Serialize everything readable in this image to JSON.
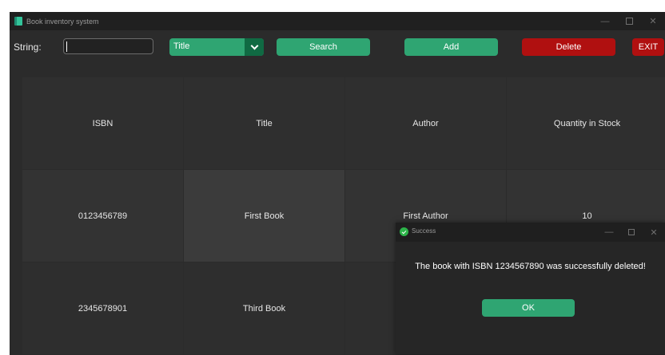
{
  "window": {
    "title": "Book inventory system",
    "controls": {
      "minimize": "—",
      "close": "✕"
    }
  },
  "toolbar": {
    "string_label": "String:",
    "search_value": "",
    "field_select_value": "Title",
    "search_label": "Search",
    "add_label": "Add",
    "delete_label": "Delete",
    "exit_label": "EXIT"
  },
  "table": {
    "headers": [
      "ISBN",
      "Title",
      "Author",
      "Quantity in Stock"
    ],
    "rows": [
      [
        "0123456789",
        "First Book",
        "First Author",
        "10"
      ],
      [
        "2345678901",
        "Third Book",
        "",
        ""
      ]
    ]
  },
  "dialog": {
    "title": "Success",
    "controls": {
      "minimize": "—",
      "close": "✕"
    },
    "message": "The book with ISBN 1234567890 was successfully deleted!",
    "ok_label": "OK"
  },
  "colors": {
    "accent": "#2fa572",
    "accent_dark": "#106a43",
    "danger": "#b01010",
    "background": "#2b2b2b"
  },
  "icons": [
    "app-book-icon",
    "minimize-icon",
    "maximize-icon",
    "close-icon",
    "chevron-down-icon",
    "success-check-icon"
  ]
}
